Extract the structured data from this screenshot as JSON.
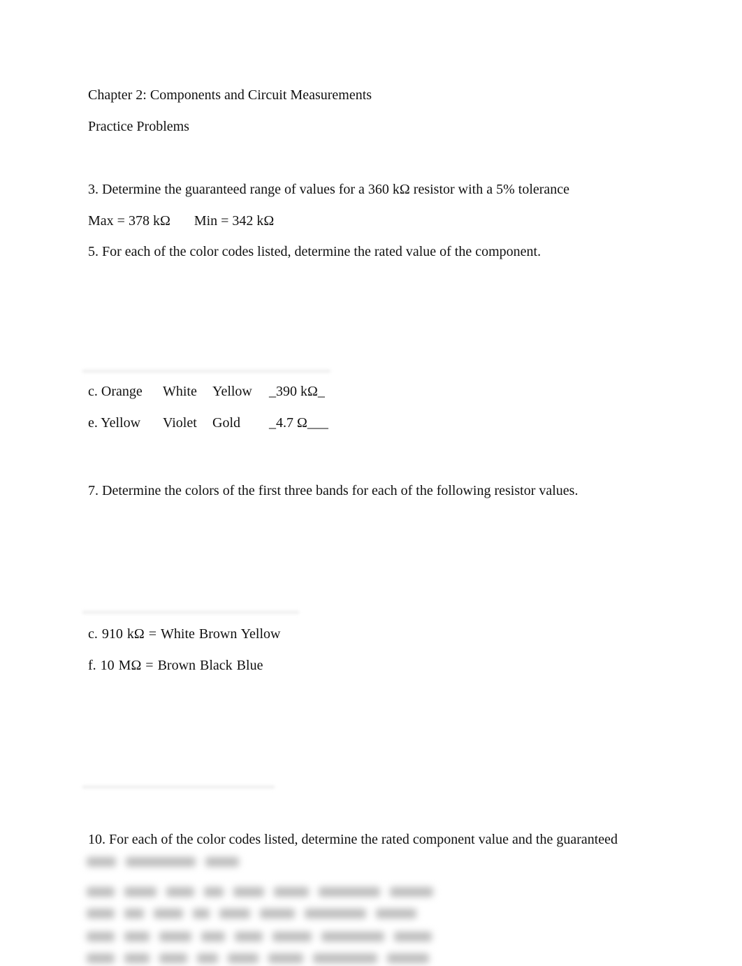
{
  "header": {
    "chapter_title": "Chapter 2: Components and Circuit Measurements",
    "subtitle": "Practice Problems"
  },
  "problem3": {
    "question": "3. Determine the guaranteed range of values for a 360 kΩ resistor with a 5% tolerance",
    "answer_max": "Max = 378 kΩ",
    "answer_min": "Min = 342 kΩ"
  },
  "problem5": {
    "question": "5. For each of the color codes listed, determine the rated value of the component.",
    "rows": [
      {
        "label": "c. Orange",
        "band2": "White",
        "band3": "Yellow",
        "answer": "_390 kΩ_"
      },
      {
        "label": "e. Yellow",
        "band2": "Violet",
        "band3": "Gold",
        "answer": "_4.7 Ω___"
      }
    ]
  },
  "problem7": {
    "question": "7. Determine the colors of the first three bands for each of the following resistor values.",
    "rows": [
      {
        "text": "c. 910 kΩ = White  Brown  Yellow"
      },
      {
        "text": "f. 10 MΩ = Brown  Black  Blue"
      }
    ]
  },
  "problem10": {
    "question": "10. For each of the color codes listed, determine the rated component value and the guaranteed",
    "obscured_note": "remaining text blurred / not legible"
  }
}
